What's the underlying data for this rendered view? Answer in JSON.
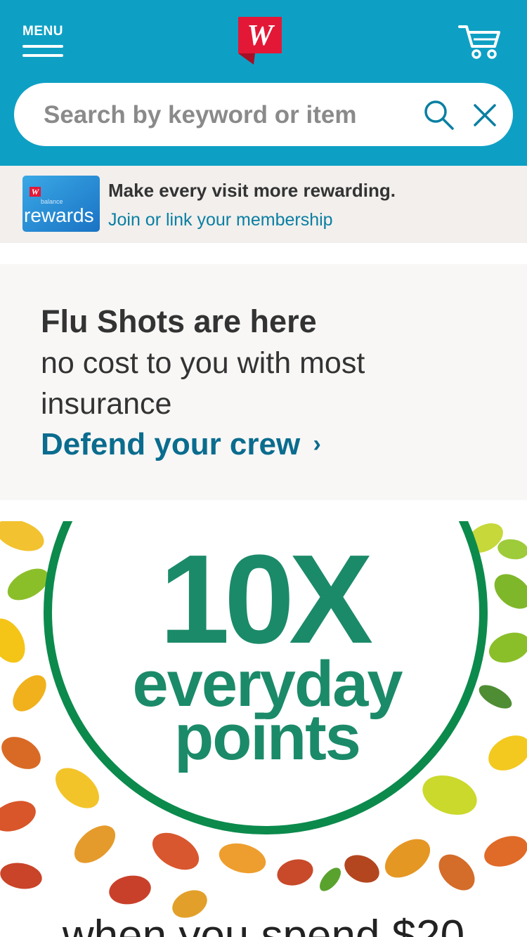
{
  "header": {
    "menu_label": "MENU",
    "logo_letter": "W",
    "brand_color": "#0ea0c4",
    "logo_color": "#e31837"
  },
  "search": {
    "placeholder": "Search by keyword or item",
    "value": ""
  },
  "rewards": {
    "card_small": "balance",
    "card_label": "rewards",
    "headline": "Make every visit more rewarding.",
    "link": "Join or link your membership"
  },
  "flu": {
    "title": "Flu Shots are here",
    "description": "no cost to you with most insurance",
    "link": "Defend your crew",
    "link_chevron": "›"
  },
  "promo": {
    "big": "10X",
    "mid": "everyday",
    "low": "points",
    "footer": "when you spend $20",
    "accent": "#1b8a69",
    "ring": "#0b8a4c"
  }
}
